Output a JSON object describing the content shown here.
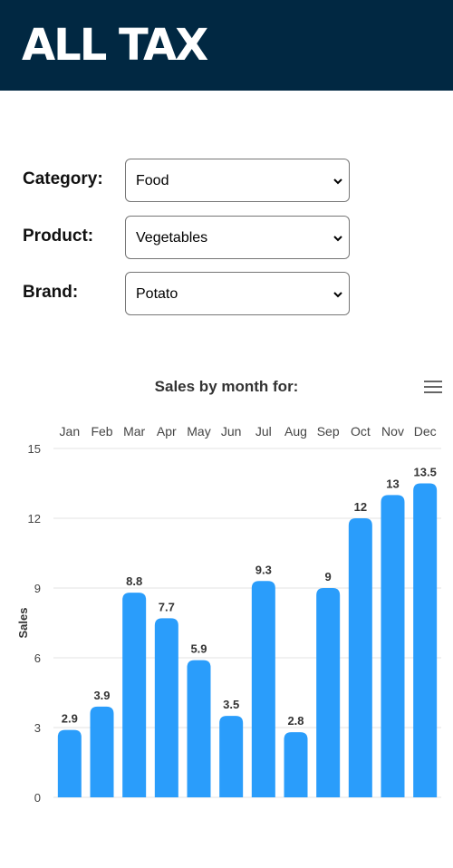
{
  "brand": {
    "logo_text": "ALL TAX"
  },
  "colors": {
    "header_bg": "#012842",
    "bar": "#2a9dfb"
  },
  "filters": [
    {
      "label": "Category:",
      "value": "Food"
    },
    {
      "label": "Product:",
      "value": "Vegetables"
    },
    {
      "label": "Brand:",
      "value": "Potato"
    }
  ],
  "icons": {
    "menu": "hamburger-menu-icon",
    "dropdown": "chevron-down-icon"
  },
  "chart_data": {
    "type": "bar",
    "title": "Sales by month for:",
    "ylabel": "Sales",
    "xlabel": "",
    "categories": [
      "Jan",
      "Feb",
      "Mar",
      "Apr",
      "May",
      "Jun",
      "Jul",
      "Aug",
      "Sep",
      "Oct",
      "Nov",
      "Dec"
    ],
    "values": [
      2.9,
      3.9,
      8.8,
      7.7,
      5.9,
      3.5,
      9.3,
      2.8,
      9,
      12,
      13,
      13.5
    ],
    "yticks": [
      0,
      3,
      6,
      9,
      12,
      15
    ],
    "ylim": [
      0,
      15
    ],
    "x_axis_position": "top",
    "grid": true,
    "data_labels": true
  }
}
